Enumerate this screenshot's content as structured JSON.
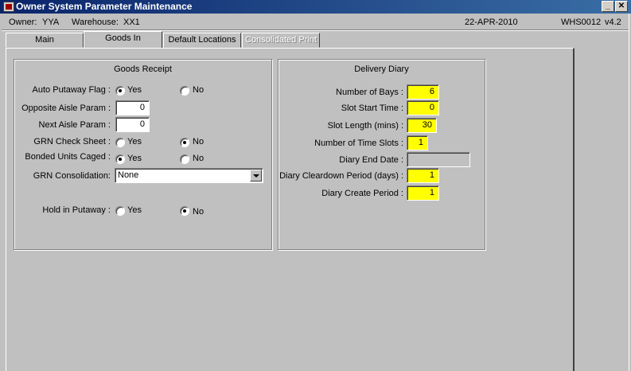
{
  "window": {
    "title": "Owner System Parameter Maintenance",
    "minimize_glyph": "_",
    "close_glyph": "✕"
  },
  "info": {
    "owner_label": "Owner:",
    "owner_value": "YYA",
    "warehouse_label": "Warehouse:",
    "warehouse_value": "XX1",
    "date": "22-APR-2010",
    "module": "WHS0012",
    "version": "v4.2"
  },
  "tabs": [
    {
      "label": "Main",
      "active": false
    },
    {
      "label": "Goods In",
      "active": true
    },
    {
      "label": "Default Locations",
      "active": false
    },
    {
      "label": "Consolidated Print",
      "active": false,
      "disabled": true
    }
  ],
  "goods_receipt": {
    "title": "Goods Receipt",
    "auto_putaway": {
      "label": "Auto Putaway Flag :",
      "yes": "Yes",
      "no": "No",
      "selected": "yes"
    },
    "opposite_aisle": {
      "label": "Opposite Aisle Param :",
      "value": "0"
    },
    "next_aisle": {
      "label": "Next Aisle Param :",
      "value": "0"
    },
    "grn_check_sheet": {
      "label": "GRN Check Sheet :",
      "yes": "Yes",
      "no": "No",
      "selected": "no"
    },
    "bonded_units": {
      "label": "Bonded Units Caged :",
      "yes": "Yes",
      "no": "No",
      "selected": "yes"
    },
    "grn_consolidation": {
      "label": "GRN Consolidation:",
      "value": "None"
    },
    "hold_in_putaway": {
      "label": "Hold in Putaway :",
      "yes": "Yes",
      "no": "No",
      "selected": "no"
    }
  },
  "delivery_diary": {
    "title": "Delivery Diary",
    "number_of_bays": {
      "label": "Number of Bays :",
      "value": "6"
    },
    "slot_start_time": {
      "label": "Slot Start Time :",
      "value": "0"
    },
    "slot_length": {
      "label": "Slot Length (mins) :",
      "value": "30"
    },
    "number_of_slots": {
      "label": "Number of Time Slots :",
      "value": "1"
    },
    "diary_end_date": {
      "label": "Diary End Date :",
      "value": ""
    },
    "cleardown_period": {
      "label": "Diary Cleardown Period (days) :",
      "value": "1"
    },
    "create_period": {
      "label": "Diary Create Period :",
      "value": "1"
    }
  },
  "colors": {
    "titlebar_start": "#0a246a",
    "titlebar_end": "#3a6ea5",
    "required_field": "#ffff00",
    "background": "#c0c0c0"
  }
}
